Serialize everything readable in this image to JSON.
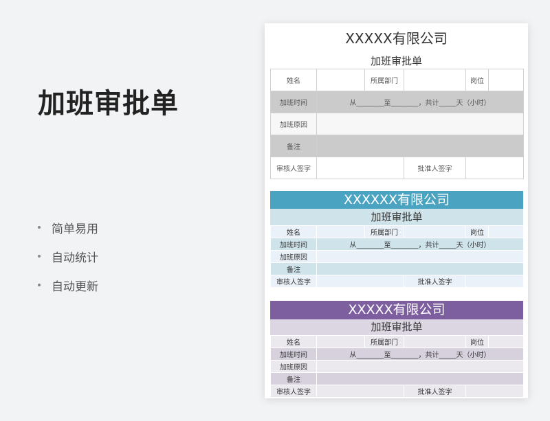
{
  "title": "加班审批单",
  "features": [
    "简单易用",
    "自动统计",
    "自动更新"
  ],
  "form1": {
    "company": "XXXXX有限公司",
    "subtitle": "加班审批单",
    "name": "姓名",
    "dept": "所属部门",
    "position": "岗位",
    "time_label": "加班时间",
    "time_value": "从________至________，共计_____天（小时）",
    "reason": "加班原因",
    "note": "备注",
    "reviewer": "审核人签字",
    "approver": "批准人签字"
  },
  "form2": {
    "company": "XXXXXX有限公司",
    "subtitle": "加班审批单",
    "name": "姓名",
    "dept": "所属部门",
    "position": "岗位",
    "time_label": "加班时间",
    "time_value": "从________至________，共计_____天（小时）",
    "reason": "加班原因",
    "note": "备注",
    "reviewer": "审核人签字",
    "approver": "批准人签字"
  },
  "form3": {
    "company": "XXXXX有限公司",
    "subtitle": "加班审批单",
    "name": "姓名",
    "dept": "所属部门",
    "position": "岗位",
    "time_label": "加班时间",
    "time_value": "从________至________，共计_____天（小时）",
    "reason": "加班原因",
    "note": "备注",
    "reviewer": "审核人签字",
    "approver": "批准人签字"
  },
  "colors": {
    "form2_header": "#4aa3c0",
    "form3_header": "#7d5fa0",
    "form1_gray_row": "#cbcbcb"
  }
}
